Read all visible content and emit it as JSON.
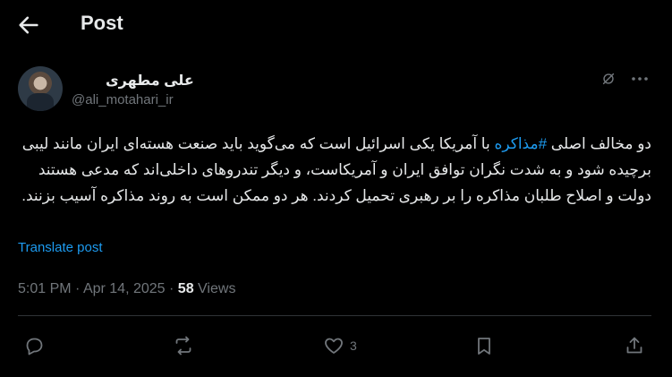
{
  "header": {
    "title": "Post"
  },
  "author": {
    "name": "علی مطهری",
    "handle": "@ali_motahari_ir"
  },
  "post": {
    "text_before": "دو مخالف اصلی ",
    "hashtag": "#مذاکره",
    "text_after": " با آمریکا یکی اسرائیل است که می‌گوید باید صنعت هسته‌ای ایران مانند لیبی برچیده شود و به شدت نگران توافق ایران و آمریکاست، و دیگر تندروهای داخلی‌اند که مدعی هستند دولت و اصلاح طلبان مذاکره را بر رهبری تحمیل کردند. هر دو ممکن است به روند مذاکره آسیب بزنند.",
    "translate_label": "Translate post"
  },
  "meta": {
    "time": "5:01 PM",
    "separator": "·",
    "date": "Apr 14, 2025",
    "views_count": "58",
    "views_label": "Views"
  },
  "actions": {
    "reply_icon": "reply-icon",
    "repost_icon": "repost-icon",
    "like_icon": "heart-icon",
    "like_count": "3",
    "bookmark_icon": "bookmark-icon",
    "share_icon": "share-icon"
  },
  "colors": {
    "background": "#000000",
    "text": "#e7e9ea",
    "muted": "#71767b",
    "accent": "#1d9bf0",
    "divider": "#2f3336"
  }
}
